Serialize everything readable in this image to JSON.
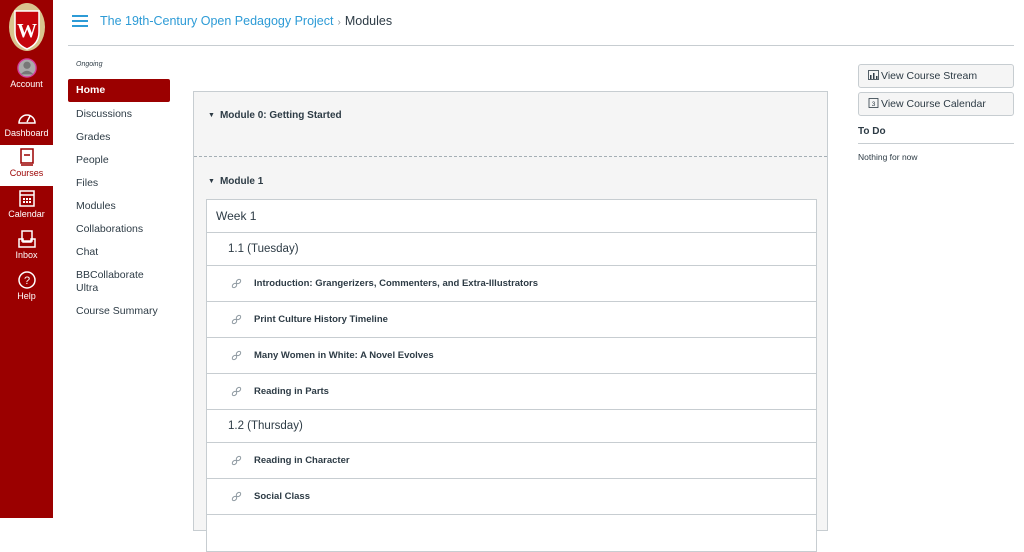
{
  "global_nav": {
    "brand": "W",
    "items": [
      {
        "label": "Account",
        "icon": "avatar-icon"
      },
      {
        "label": "Dashboard",
        "icon": "dashboard-icon"
      },
      {
        "label": "Courses",
        "icon": "courses-icon",
        "active": true
      },
      {
        "label": "Calendar",
        "icon": "calendar-icon"
      },
      {
        "label": "Inbox",
        "icon": "inbox-icon"
      },
      {
        "label": "Help",
        "icon": "help-icon"
      }
    ]
  },
  "header": {
    "course_title": "The 19th-Century Open Pedagogy Project",
    "separator": "›",
    "current_page": "Modules"
  },
  "course_nav": {
    "term": "Ongoing",
    "items": [
      {
        "label": "Home",
        "active": true
      },
      {
        "label": "Discussions"
      },
      {
        "label": "Grades"
      },
      {
        "label": "People"
      },
      {
        "label": "Files"
      },
      {
        "label": "Modules"
      },
      {
        "label": "Collaborations"
      },
      {
        "label": "Chat"
      },
      {
        "label": "BBCollaborate Ultra"
      },
      {
        "label": "Course Summary"
      }
    ]
  },
  "modules": [
    {
      "title": "Module 0: Getting Started",
      "collapse_icon": "triangle-down-icon"
    },
    {
      "title": "Module 1",
      "collapse_icon": "triangle-down-icon",
      "rows": [
        {
          "type": "week",
          "label": "Week 1"
        },
        {
          "type": "sub",
          "label": "1.1 (Tuesday)"
        },
        {
          "type": "item",
          "label": "Introduction: Grangerizers, Commenters, and Extra-Illustrators",
          "icon": "link-icon"
        },
        {
          "type": "item",
          "label": "Print Culture History Timeline",
          "icon": "link-icon"
        },
        {
          "type": "item",
          "label": "Many Women in White: A Novel Evolves",
          "icon": "link-icon"
        },
        {
          "type": "item",
          "label": "Reading in Parts",
          "icon": "link-icon"
        },
        {
          "type": "sub",
          "label": "1.2 (Thursday)"
        },
        {
          "type": "item",
          "label": "Reading in Character",
          "icon": "link-icon"
        },
        {
          "type": "item",
          "label": "Social Class",
          "icon": "link-icon"
        }
      ]
    }
  ],
  "sidebar_right": {
    "buttons": [
      {
        "label": "View Course Stream",
        "icon": "stream-icon"
      },
      {
        "label": "View Course Calendar",
        "icon": "calendar-icon"
      }
    ],
    "todo_title": "To Do",
    "todo_empty": "Nothing for now"
  },
  "colors": {
    "brand": "#9b0000",
    "link": "#2d9bd6",
    "text": "#2d3b45"
  }
}
